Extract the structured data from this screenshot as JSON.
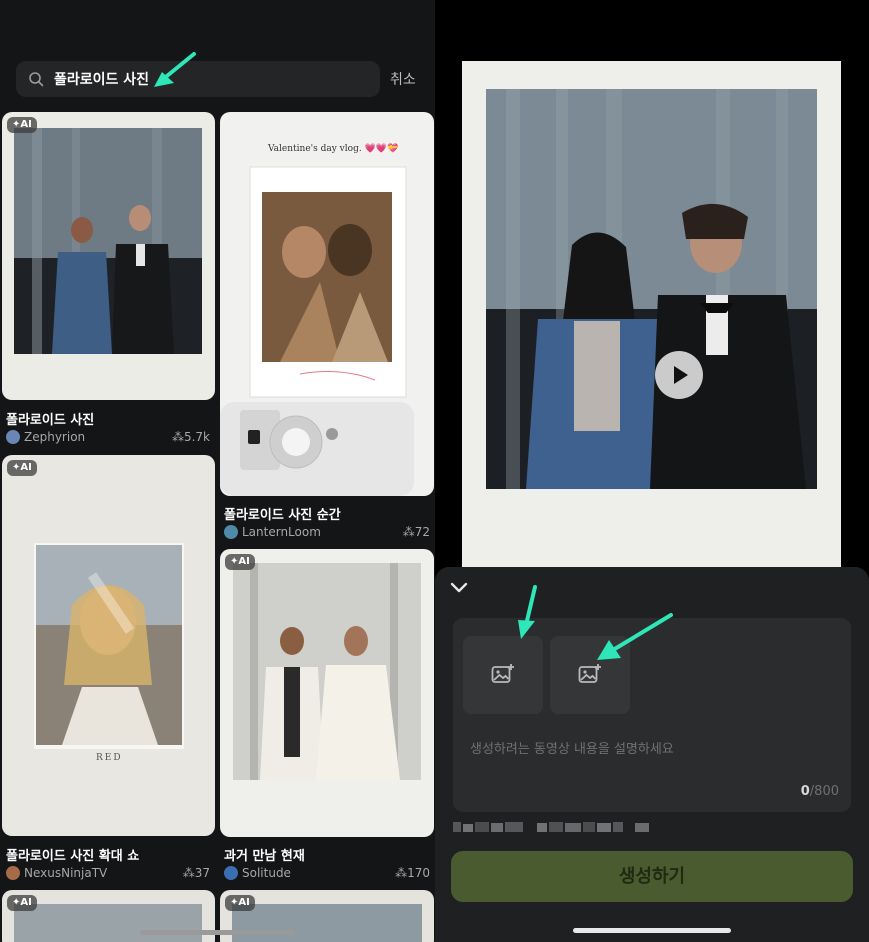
{
  "search": {
    "query": "폴라로이드 사진",
    "cancel_label": "취소"
  },
  "ai_badge": "✦AI",
  "cards": [
    {
      "title": "폴라로이드 사진",
      "author": "Zephyrion",
      "count": "⁂5.7k"
    },
    {
      "title": "폴라로이드 사진 순간",
      "author": "LanternLoom",
      "count": "⁂72",
      "overlay_text": "Valentine's day vlog. 💗💗💝"
    },
    {
      "title": "폴라로이드 사진 확대 쇼",
      "author": "NexusNinjaTV",
      "count": "⁂37",
      "overlay_text": "RED"
    },
    {
      "title": "과거 만남 현재",
      "author": "Solitude",
      "count": "⁂170"
    }
  ],
  "composer": {
    "placeholder": "생성하려는 동영상 내용을 설명하세요",
    "char_count": "0",
    "char_limit": "/800",
    "generate_label": "생성하기"
  },
  "icons": {
    "search": "search-icon",
    "collapse": "chevron-down-icon",
    "upload": "add-image-icon",
    "play": "play-icon",
    "remix": "remix-icon"
  },
  "colors": {
    "accent_arrow": "#2ee6b8",
    "generate_button": "#4a5c2f"
  }
}
